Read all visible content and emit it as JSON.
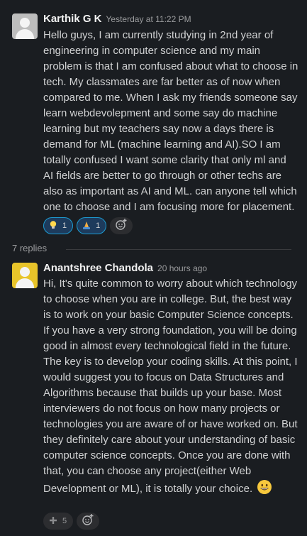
{
  "messages": [
    {
      "author": "Karthik G K",
      "timestamp": "Yesterday at 11:22 PM",
      "avatar": "default-avatar",
      "text": "Hello guys, I am currently studying in 2nd year of engineering in computer science and my main problem is that I am confused about what to choose in tech. My classmates are far better as of now when compared to me. When I ask my friends someone say learn webdevolepment and some say do machine learning but my teachers say now a days there is demand for ML (machine learning and AI).SO I am totally confused I want some clarity that only ml and AI fields are better to go through or other techs are also as important as AI and ML. can anyone tell which one to choose and I am focusing more for placement.",
      "reactions": [
        {
          "emoji": "bulb-icon",
          "count": "1"
        },
        {
          "emoji": "pray-icon",
          "count": "1"
        }
      ]
    },
    {
      "author": "Anantshree Chandola",
      "timestamp": "20 hours ago",
      "avatar": "yellow-avatar",
      "text": "Hi, It's quite common to worry about which technology to choose when you are in college. But, the best way is to work on your basic Computer Science concepts. If you have a very strong foundation, you will be doing good in almost every technological field in the future. The key is to develop your coding skills. At this point, I would suggest you to focus on Data Structures and Algorithms because that builds up your base. Most interviewers do not focus on how many projects or technologies you are aware of or have worked on. But they definitely care about your understanding of basic computer science concepts. Once you are done with that, you can choose any project(either Web Development or ML), it is totally your choice.",
      "reactions": [
        {
          "emoji": "heavy-plus-icon",
          "count": "5"
        }
      ]
    }
  ],
  "thread": {
    "replies_label": "7 replies"
  },
  "colors": {
    "background": "#1a1d21",
    "reaction_active_border": "#1d9bd1",
    "reaction_active_bg": "#1d3b5c",
    "avatar_yellow": "#e8c42a"
  }
}
